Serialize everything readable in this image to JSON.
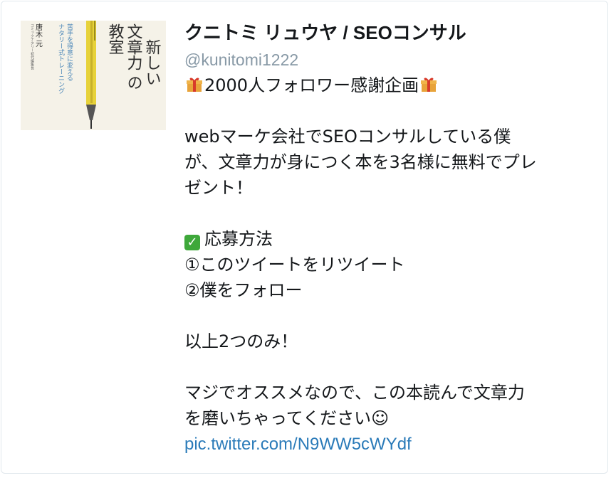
{
  "tweet": {
    "display_name": "クニトミ リュウヤ / SEOコンサル",
    "handle": "@kunitomi1222",
    "lines": [
      "2000人フォロワー感謝企画",
      "",
      "webマーケ会社でSEOコンサルしている僕",
      "が、文章力が身につく本を3名様に無料でプレ",
      "ゼント！",
      "",
      "応募方法",
      "①このツイートをリツイート",
      "②僕をフォロー",
      "",
      "以上2つのみ！",
      "",
      "マジでオススメなので、この本読んで文章力",
      "を磨いちゃってください☺"
    ],
    "link": "pic.twitter.com/N9WW5cWYdf"
  },
  "book_cover": {
    "title_line1": "新しい",
    "title_line2": "文章力",
    "title_line3": "の",
    "title_line4": "教室",
    "subtitle_a": "苦手を得意に変える",
    "subtitle_b": "ナタリー式トレーニング",
    "author": "唐木 元",
    "author_affil": "コミックナタリー初代編集長"
  },
  "colors": {
    "link": "#2b7bb9",
    "handle": "#8899a6",
    "check": "#3ea83a"
  }
}
